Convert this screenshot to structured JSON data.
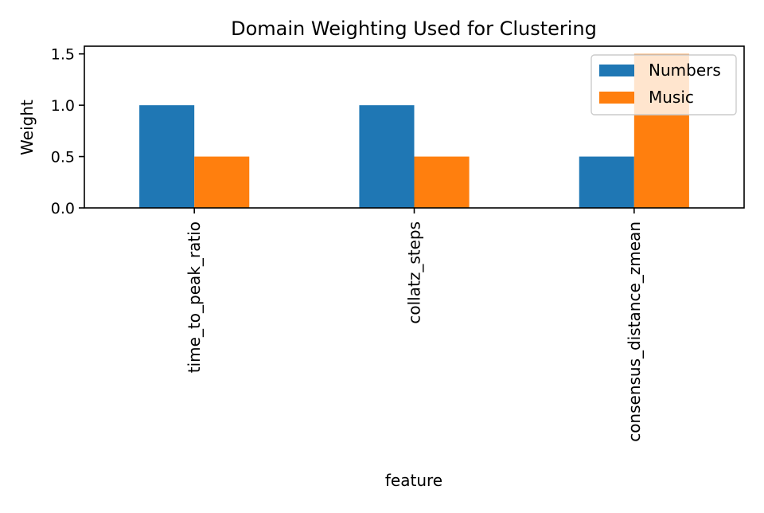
{
  "chart_data": {
    "type": "bar",
    "title": "Domain Weighting Used for Clustering",
    "xlabel": "feature",
    "ylabel": "Weight",
    "categories": [
      "time_to_peak_ratio",
      "collatz_steps",
      "consensus_distance_zmean"
    ],
    "series": [
      {
        "name": "Numbers",
        "values": [
          1.0,
          1.0,
          0.5
        ],
        "color": "#1f77b4"
      },
      {
        "name": "Music",
        "values": [
          0.5,
          0.5,
          1.5
        ],
        "color": "#ff7f0e"
      }
    ],
    "ylim": [
      0,
      1.575
    ],
    "yticks": [
      0.0,
      0.5,
      1.0,
      1.5
    ],
    "ytick_labels": [
      "0.0",
      "0.5",
      "1.0",
      "1.5"
    ],
    "grid": false,
    "legend_position": "top-right"
  }
}
